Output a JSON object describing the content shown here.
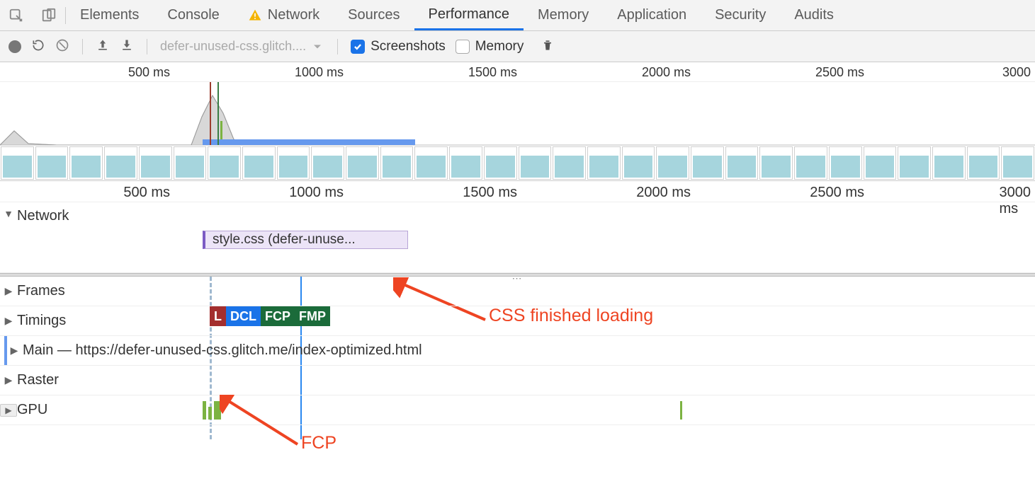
{
  "tabs": [
    "Elements",
    "Console",
    "Network",
    "Sources",
    "Performance",
    "Memory",
    "Application",
    "Security",
    "Audits"
  ],
  "active_tab": "Performance",
  "warn_tab": "Network",
  "toolbar": {
    "dropdown": "defer-unused-css.glitch....",
    "screenshots_label": "Screenshots",
    "memory_label": "Memory"
  },
  "ruler1": [
    "500 ms",
    "1000 ms",
    "1500 ms",
    "2000 ms",
    "2500 ms",
    "3000"
  ],
  "ruler2": [
    "500 ms",
    "1000 ms",
    "1500 ms",
    "2000 ms",
    "2500 ms",
    "3000 ms"
  ],
  "tracks": {
    "network": "Network",
    "css_block": "style.css (defer-unuse...",
    "frames": "Frames",
    "timings": "Timings",
    "main": "Main — https://defer-unused-css.glitch.me/index-optimized.html",
    "raster": "Raster",
    "gpu": "GPU"
  },
  "timing_badges": [
    {
      "label": "L",
      "cls": "red"
    },
    {
      "label": "DCL",
      "cls": "blue"
    },
    {
      "label": "FCP",
      "cls": "green"
    },
    {
      "label": "FMP",
      "cls": "green"
    }
  ],
  "annotations": {
    "css": "CSS finished loading",
    "fcp": "FCP"
  }
}
